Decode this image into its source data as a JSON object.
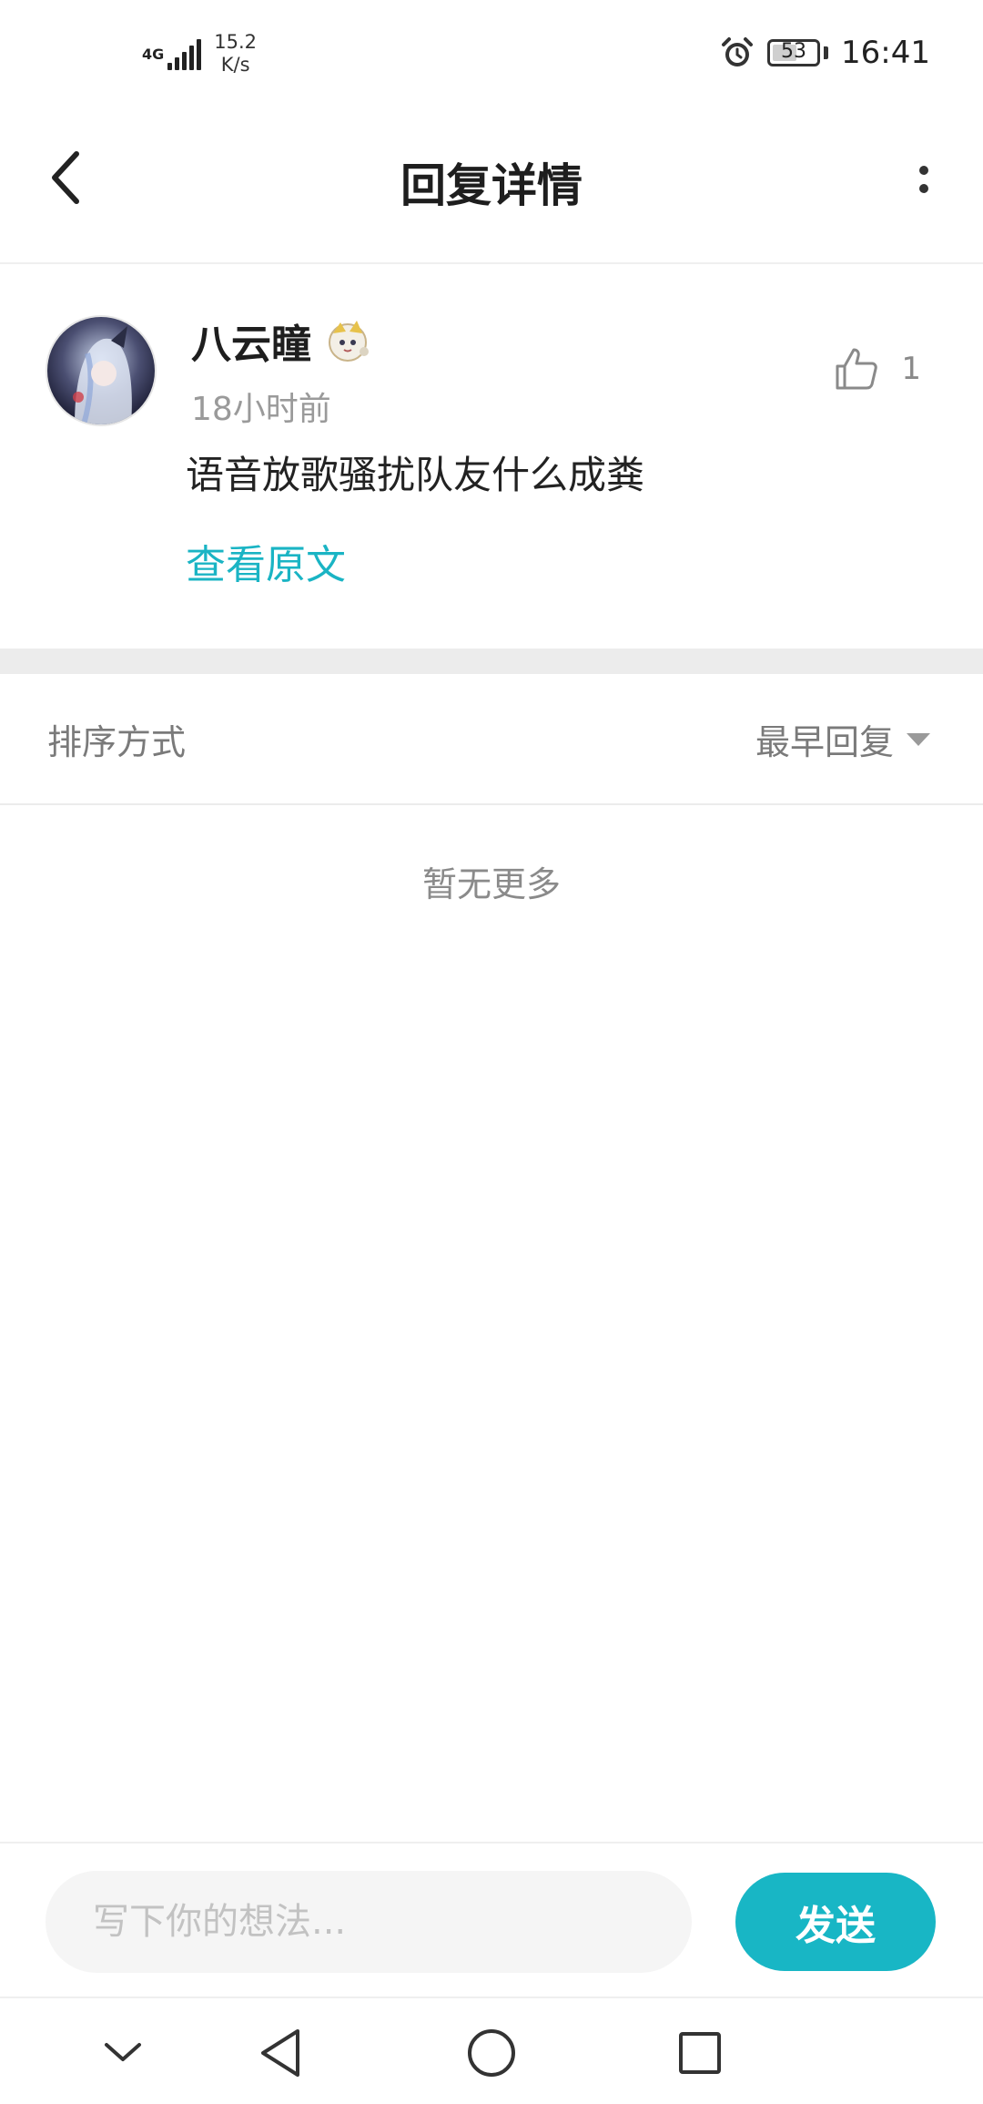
{
  "status_bar": {
    "network": "4G",
    "speed_value": "15.2",
    "speed_unit": "K/s",
    "battery": "53",
    "time": "16:41"
  },
  "header": {
    "title": "回复详情"
  },
  "reply": {
    "username": "八云瞳",
    "timestamp": "18小时前",
    "like_count": "1",
    "text": "语音放歌骚扰队友什么成粪",
    "view_original": "查看原文"
  },
  "sort": {
    "label": "排序方式",
    "value": "最早回复"
  },
  "empty_state": "暂无更多",
  "input_bar": {
    "placeholder": "写下你的想法...",
    "send_label": "发送"
  },
  "colors": {
    "accent": "#18b6c5",
    "text_secondary": "#9a9a9a",
    "divider": "#ececec"
  },
  "icons": [
    "back-chevron-icon",
    "more-vertical-icon",
    "thumbs-up-icon",
    "alarm-icon",
    "nav-down-icon",
    "nav-back-icon",
    "nav-home-icon",
    "nav-recents-icon"
  ]
}
